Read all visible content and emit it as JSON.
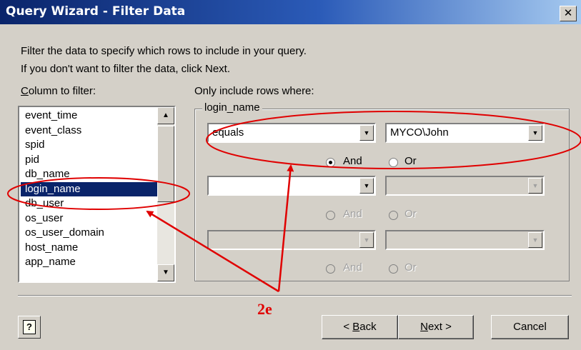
{
  "window": {
    "title": "Query Wizard - Filter Data",
    "close_glyph": "✕"
  },
  "instructions": {
    "line1": "Filter the data to specify which rows to include in your query.",
    "line2": "If you don't want to filter the data, click Next."
  },
  "column_label": {
    "u": "C",
    "rest": "olumn to filter:"
  },
  "rows_label": "Only include rows where:",
  "columns": [
    "event_time",
    "event_class",
    "spid",
    "pid",
    "db_name",
    "login_name",
    "db_user",
    "os_user",
    "os_user_domain",
    "host_name",
    "app_name"
  ],
  "selected_column": "login_name",
  "group_title": "login_name",
  "conditions": [
    {
      "operator": "equals",
      "value": "MYCO\\John",
      "and": "And",
      "or": "Or",
      "and_checked": true,
      "enabled": true
    },
    {
      "operator": "",
      "value": "",
      "and": "And",
      "or": "Or",
      "and_checked": false,
      "enabled": false
    },
    {
      "operator": "",
      "value": "",
      "and": "And",
      "or": "Or",
      "and_checked": false,
      "enabled": false
    }
  ],
  "buttons": {
    "back": {
      "u": "B",
      "before": "< ",
      "after": "ack"
    },
    "next": {
      "u": "N",
      "after": "ext >"
    },
    "cancel": "Cancel",
    "help_glyph": "?"
  },
  "annotation": {
    "label": "2e",
    "color": "#e00000"
  }
}
